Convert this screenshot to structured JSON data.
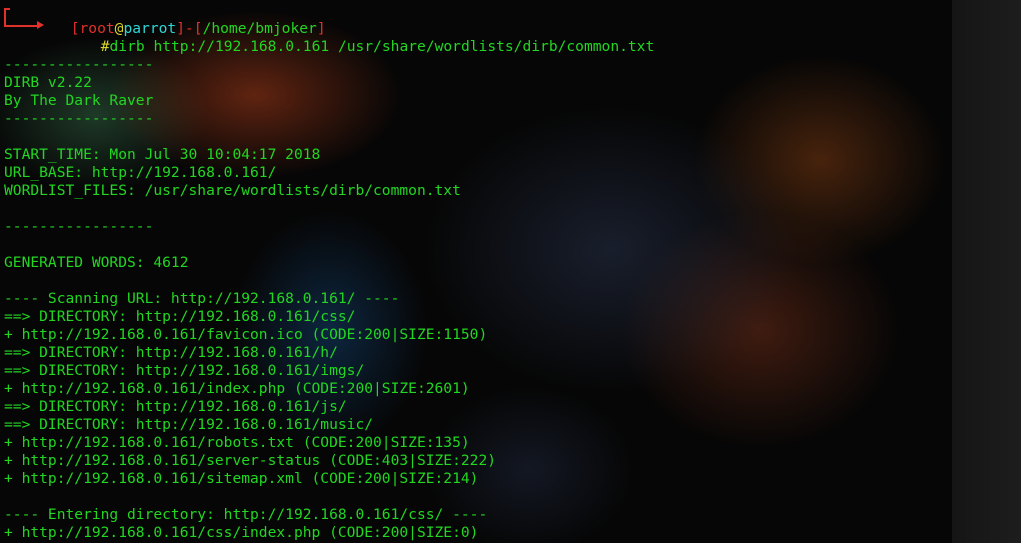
{
  "prompt": {
    "open_bracket": "[",
    "user": "root",
    "at": "@",
    "host": "parrot",
    "close_bracket": "]",
    "dash": "-",
    "cwd_open": "[",
    "cwd": "/home/bmjoker",
    "cwd_close": "]",
    "hash": "#",
    "command": "dirb http://192.168.0.161 /usr/share/wordlists/dirb/common.txt"
  },
  "output": [
    "",
    "-----------------",
    "DIRB v2.22",
    "By The Dark Raver",
    "-----------------",
    "",
    "START_TIME: Mon Jul 30 10:04:17 2018",
    "URL_BASE: http://192.168.0.161/",
    "WORDLIST_FILES: /usr/share/wordlists/dirb/common.txt",
    "",
    "-----------------",
    "",
    "GENERATED WORDS: 4612",
    "",
    "---- Scanning URL: http://192.168.0.161/ ----",
    "==> DIRECTORY: http://192.168.0.161/css/",
    "+ http://192.168.0.161/favicon.ico (CODE:200|SIZE:1150)",
    "==> DIRECTORY: http://192.168.0.161/h/",
    "==> DIRECTORY: http://192.168.0.161/imgs/",
    "+ http://192.168.0.161/index.php (CODE:200|SIZE:2601)",
    "==> DIRECTORY: http://192.168.0.161/js/",
    "==> DIRECTORY: http://192.168.0.161/music/",
    "+ http://192.168.0.161/robots.txt (CODE:200|SIZE:135)",
    "+ http://192.168.0.161/server-status (CODE:403|SIZE:222)",
    "+ http://192.168.0.161/sitemap.xml (CODE:200|SIZE:214)",
    "",
    "---- Entering directory: http://192.168.0.161/css/ ----",
    "+ http://192.168.0.161/css/index.php (CODE:200|SIZE:0)"
  ],
  "colors": {
    "output": "#22d622",
    "prompt_frame": "#e0312b",
    "user": "#2fd6d6",
    "host": "#2fd6d6",
    "hash": "#d8d52b"
  }
}
